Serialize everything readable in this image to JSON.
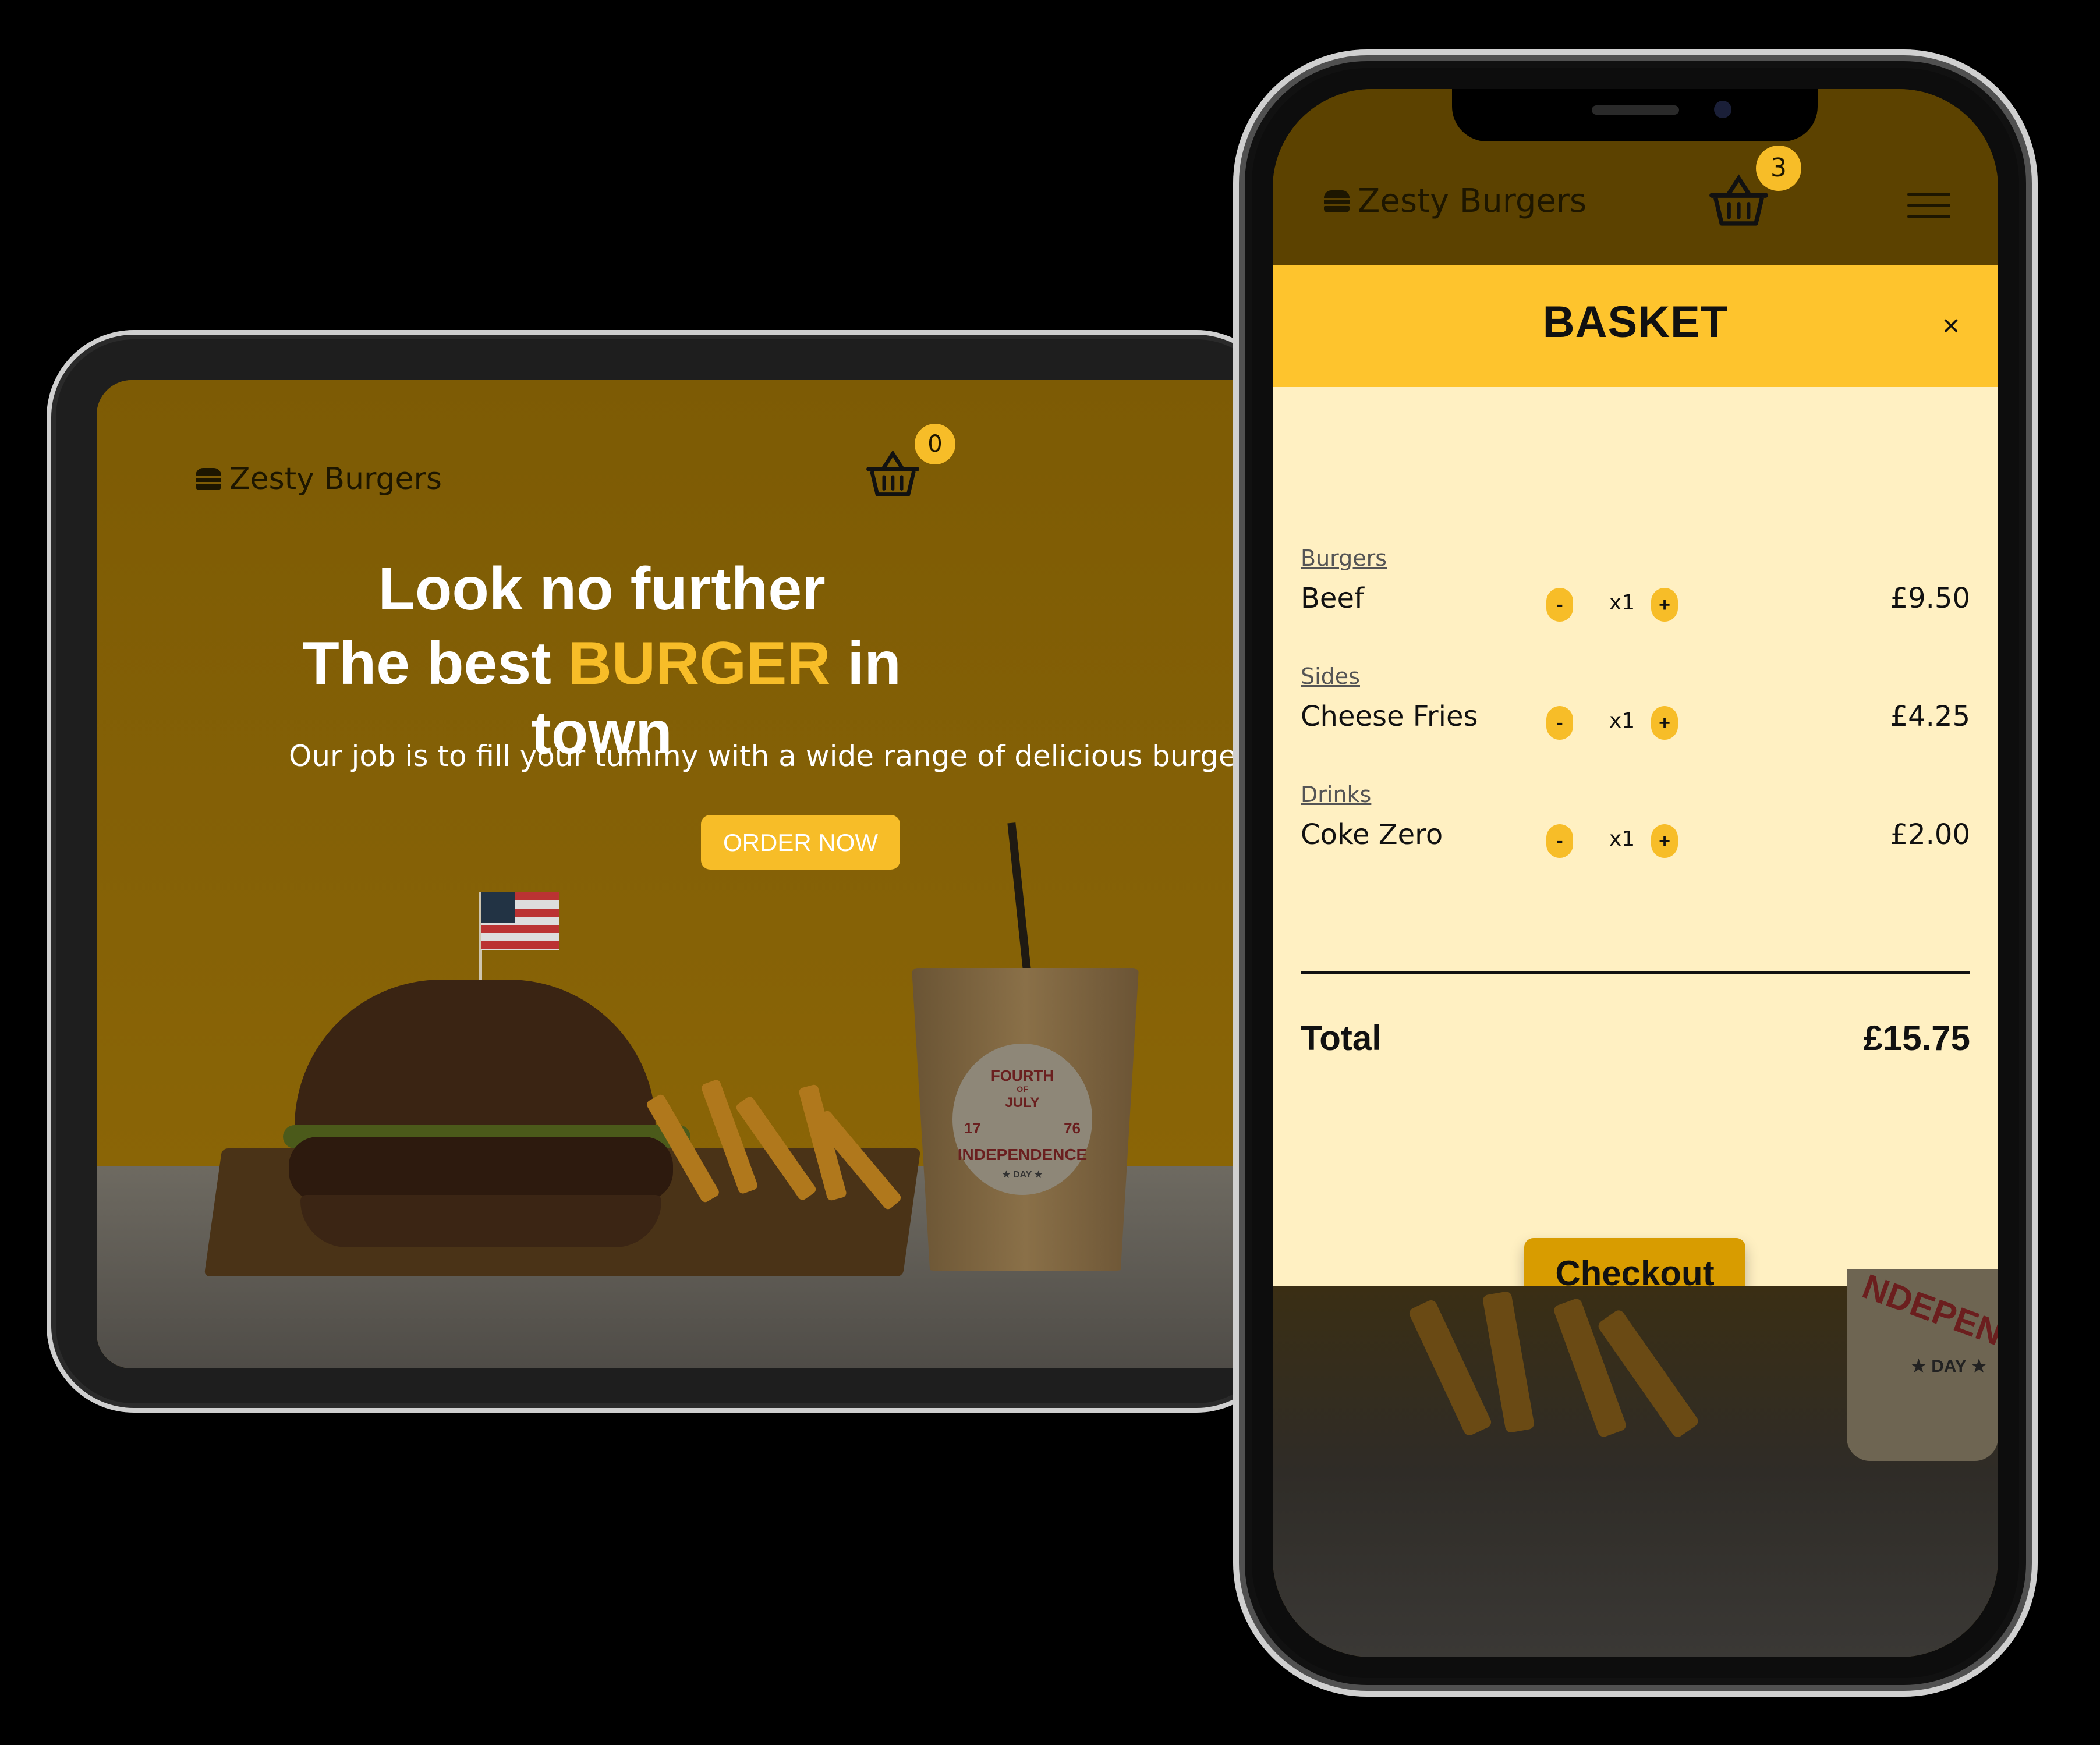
{
  "brand": "Zesty Burgers",
  "tablet": {
    "basket_count": "0",
    "hero_line1": "Look no further",
    "hero_line2_pre": "The best ",
    "hero_line2_highlight": "BURGER",
    "hero_line2_post": " in town",
    "subtitle": "Our job is to fill your tummy with a wide range of delicious burgers.",
    "order_button": "ORDER NOW",
    "cup_text": {
      "top": "FOURTH",
      "of": "OF",
      "month": "JULY",
      "year_left": "17",
      "year_right": "76",
      "word": "INDEPENDENCE",
      "day": "★ DAY ★"
    }
  },
  "phone": {
    "basket_count": "3",
    "basket_title": "BASKET",
    "close_label": "×",
    "items": [
      {
        "category": "Burgers",
        "name": "Beef",
        "qty": "x1",
        "price": "£9.50"
      },
      {
        "category": "Sides",
        "name": "Cheese Fries",
        "qty": "x1",
        "price": "£4.25"
      },
      {
        "category": "Drinks",
        "name": "Coke Zero",
        "qty": "x1",
        "price": "£2.00"
      }
    ],
    "minus_label": "-",
    "plus_label": "+",
    "total_label": "Total",
    "total_value": "£15.75",
    "checkout_label": "Checkout",
    "bg_cup_text": "NDEPENDE",
    "bg_cup_day": "★ DAY ★"
  },
  "colors": {
    "accent": "#f7bd28",
    "panel": "#fff0c2",
    "header_dim": "#5c4200",
    "checkout": "#d89c00"
  },
  "icons": {
    "logo": "burger-icon",
    "basket": "basket-icon",
    "menu": "hamburger-menu-icon",
    "close": "close-icon"
  }
}
